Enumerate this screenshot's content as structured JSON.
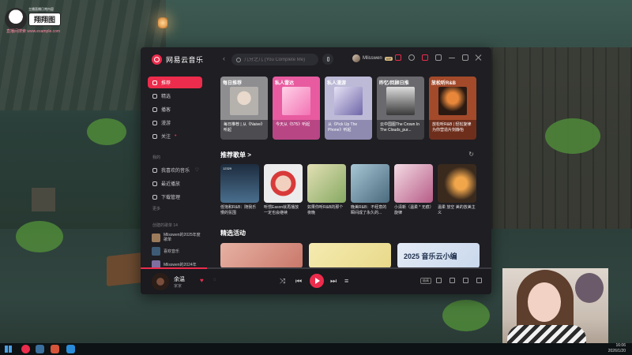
{
  "stream_overlay": {
    "logo_tag": "翔翔图",
    "logo_sub": "主播直播日常内容",
    "logo_sub2": "直播间搜索 www.example.com"
  },
  "app": {
    "name": "网易云音乐",
    "search_placeholder": "几分之几 (You Complete Me)",
    "user_name": "Mlisswen",
    "vip_badge": "VIP"
  },
  "sidebar": {
    "items": [
      {
        "label": "推荐",
        "active": true
      },
      {
        "label": "精选"
      },
      {
        "label": "播客"
      },
      {
        "label": "漫游"
      },
      {
        "label": "关注"
      }
    ],
    "mine_title": "我的",
    "mine_items": [
      {
        "label": "我喜欢的音乐"
      },
      {
        "label": "最近播放"
      },
      {
        "label": "下载管理"
      }
    ],
    "more_label": "更多",
    "created_title": "创建的歌单 14",
    "playlists": [
      {
        "label": "Mlisswen的2025年度歌单"
      },
      {
        "label": "喜欢音乐"
      },
      {
        "label": "Mlisswen的2024年"
      }
    ]
  },
  "daily_cards": [
    {
      "tag": "每日推荐",
      "text": "每日推荐 | 从《Naive》听起",
      "color": "#c7c7c9"
    },
    {
      "tag": "私人雷达",
      "text": "今天从《5?5》听起",
      "color": "#e85ba0"
    },
    {
      "tag": "私人漫游",
      "text": "从《Pick Up The Phone》听起",
      "color": "#bcbad6"
    },
    {
      "tag": "昨忆/回顾日推",
      "text": "云中国图The Crown In The Clouds_pur...",
      "color": "#6a6a6e"
    },
    {
      "tag": "放松听R&B",
      "text": "放松听R&B | 轻松旋律为你营造片刻静怡",
      "color": "#a34a2a"
    }
  ],
  "recommend_title": "推荐歌单 >",
  "recommend_playlists": [
    {
      "count": "12329",
      "title": "低饱和R&B：随我乐慢的氛围"
    },
    {
      "count": "",
      "title": "听惯Eason就再播放一定也会继续"
    },
    {
      "count": "",
      "title": "如果你听R&B的那个夜晚"
    },
    {
      "count": "",
      "title": "晚美R&B：不经意的瞬间成了永久的..."
    },
    {
      "count": "",
      "title": "小清新（温柔 * 无痕）旋律"
    },
    {
      "count": "",
      "title": "温柔 放空 美的放美主义"
    }
  ],
  "activity_title": "精选活动",
  "activities": [
    {
      "label": "activity-1",
      "color": "#c9786a"
    },
    {
      "label": "activity-2",
      "color": "#e8d98a"
    },
    {
      "label": "2025 音乐云小编",
      "color": "#c9d8ec"
    }
  ],
  "player": {
    "title": "余温",
    "artist": "家家",
    "quality": "极高",
    "progress": 0.19
  },
  "taskbar": {
    "time": "16:06",
    "date": "2026/1/20"
  },
  "colors": {
    "accent": "#ec2c4c",
    "app_bg": "#1e1e23",
    "player_bg": "#1a1a1f"
  }
}
